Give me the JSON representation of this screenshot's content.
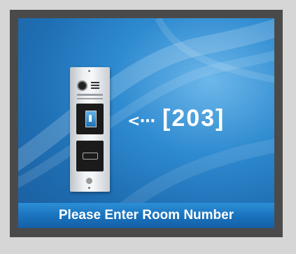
{
  "display": {
    "arrow_glyph": "<···",
    "room_number": "[203]",
    "prompt": "Please Enter Room Number"
  },
  "icons": {
    "door_station": "door-intercom-panel-icon",
    "arrow": "arrow-left-icon"
  },
  "colors": {
    "background": "#d6d6d6",
    "bezel": "#4a4a4a",
    "screen_blue": "#2f8bd0",
    "bar_blue": "#1a73be",
    "text": "#ffffff"
  }
}
